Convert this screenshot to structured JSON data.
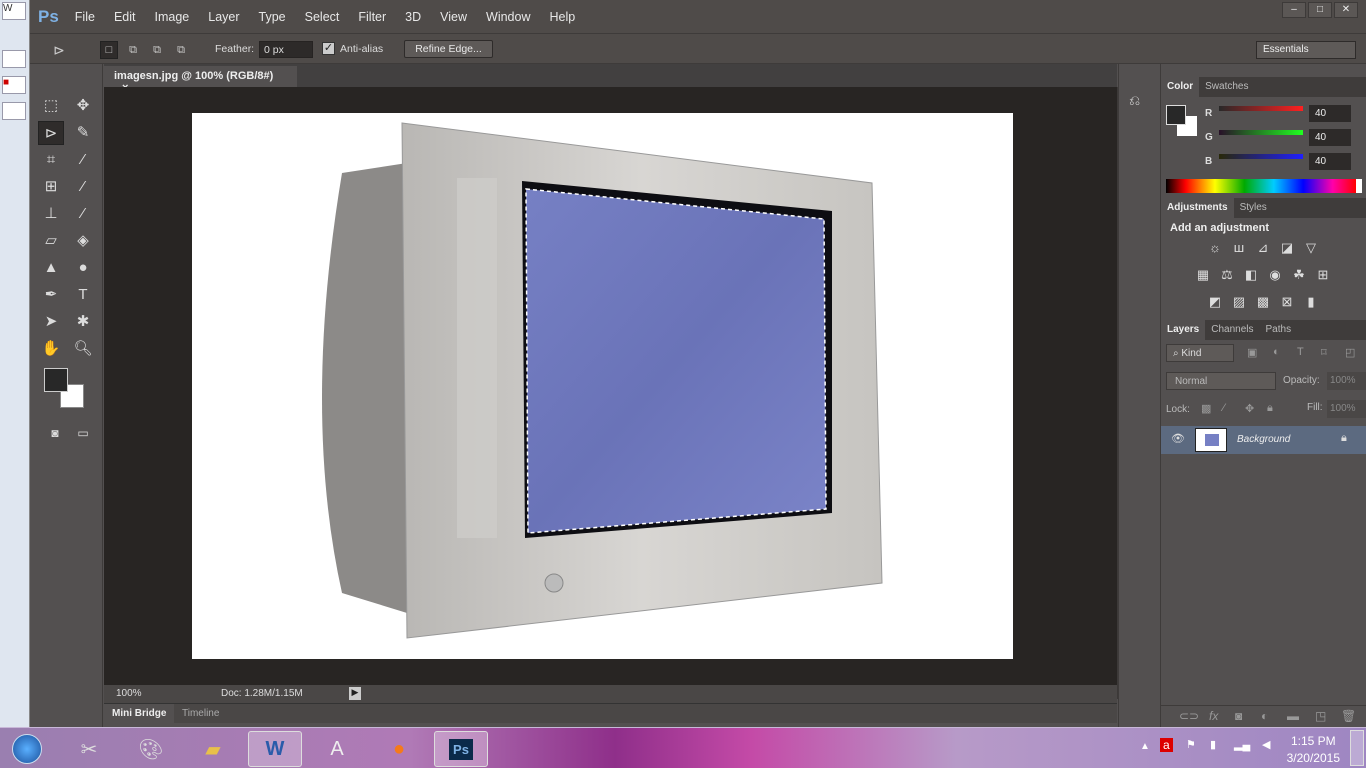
{
  "app": {
    "logo": "Ps",
    "menus": [
      "File",
      "Edit",
      "Image",
      "Layer",
      "Type",
      "Select",
      "Filter",
      "3D",
      "View",
      "Window",
      "Help"
    ],
    "window_buttons": [
      "–",
      "□",
      "✕"
    ]
  },
  "options": {
    "feather_label": "Feather:",
    "feather_value": "0 px",
    "antialias_label": "Anti-alias",
    "antialias_checked": true,
    "refine_edge": "Refine Edge...",
    "workspace": "Essentials"
  },
  "document": {
    "tab": "imagesn.jpg @ 100% (RGB/8#)",
    "close": "×",
    "zoom": "100%",
    "doc_size": "Doc: 1.28M/1.15M"
  },
  "bottom_tabs": [
    "Mini Bridge",
    "Timeline"
  ],
  "color_panel": {
    "tabs": [
      "Color",
      "Swatches"
    ],
    "r_label": "R",
    "g_label": "G",
    "b_label": "B",
    "r": "40",
    "g": "40",
    "b": "40",
    "foreground": "#282828",
    "background": "#ffffff"
  },
  "adjustments": {
    "tabs": [
      "Adjustments",
      "Styles"
    ],
    "heading": "Add an adjustment"
  },
  "layers": {
    "tabs": [
      "Layers",
      "Channels",
      "Paths"
    ],
    "filter": "Kind",
    "blend_mode": "Normal",
    "opacity_label": "Opacity:",
    "opacity": "100%",
    "lock_label": "Lock:",
    "fill_label": "Fill:",
    "fill": "100%",
    "items": [
      {
        "name": "Background",
        "visible": true,
        "locked": true
      }
    ]
  },
  "taskbar": {
    "time": "1:15 PM",
    "date": "3/20/2015"
  },
  "colors": {
    "accent": "#7fb2e5",
    "selected_layer": "#5c6a80"
  }
}
